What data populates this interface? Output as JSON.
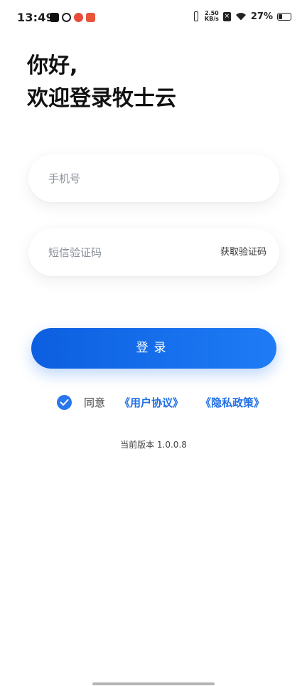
{
  "status_bar": {
    "time": "13:49",
    "app_icons": [
      "tiktok-icon",
      "link-icon",
      "weibo-icon",
      "news-icon"
    ],
    "net_speed_value": "2.50",
    "net_speed_unit": "KB/s",
    "battery": "27%",
    "battery_level": 0.27
  },
  "greeting": {
    "line1": "你好,",
    "line2": "欢迎登录牧士云"
  },
  "form": {
    "phone_placeholder": "手机号",
    "code_placeholder": "短信验证码",
    "get_code_label": "获取验证码",
    "login_label": "登录"
  },
  "agreement": {
    "checked": true,
    "agree_text": "同意",
    "user_agreement": "《用户协议》",
    "privacy_policy": "《隐私政策》"
  },
  "version": "当前版本 1.0.0.8",
  "colors": {
    "primary": "#1f6fe6",
    "button_start": "#0c5fe0",
    "button_end": "#1f7cf6"
  }
}
